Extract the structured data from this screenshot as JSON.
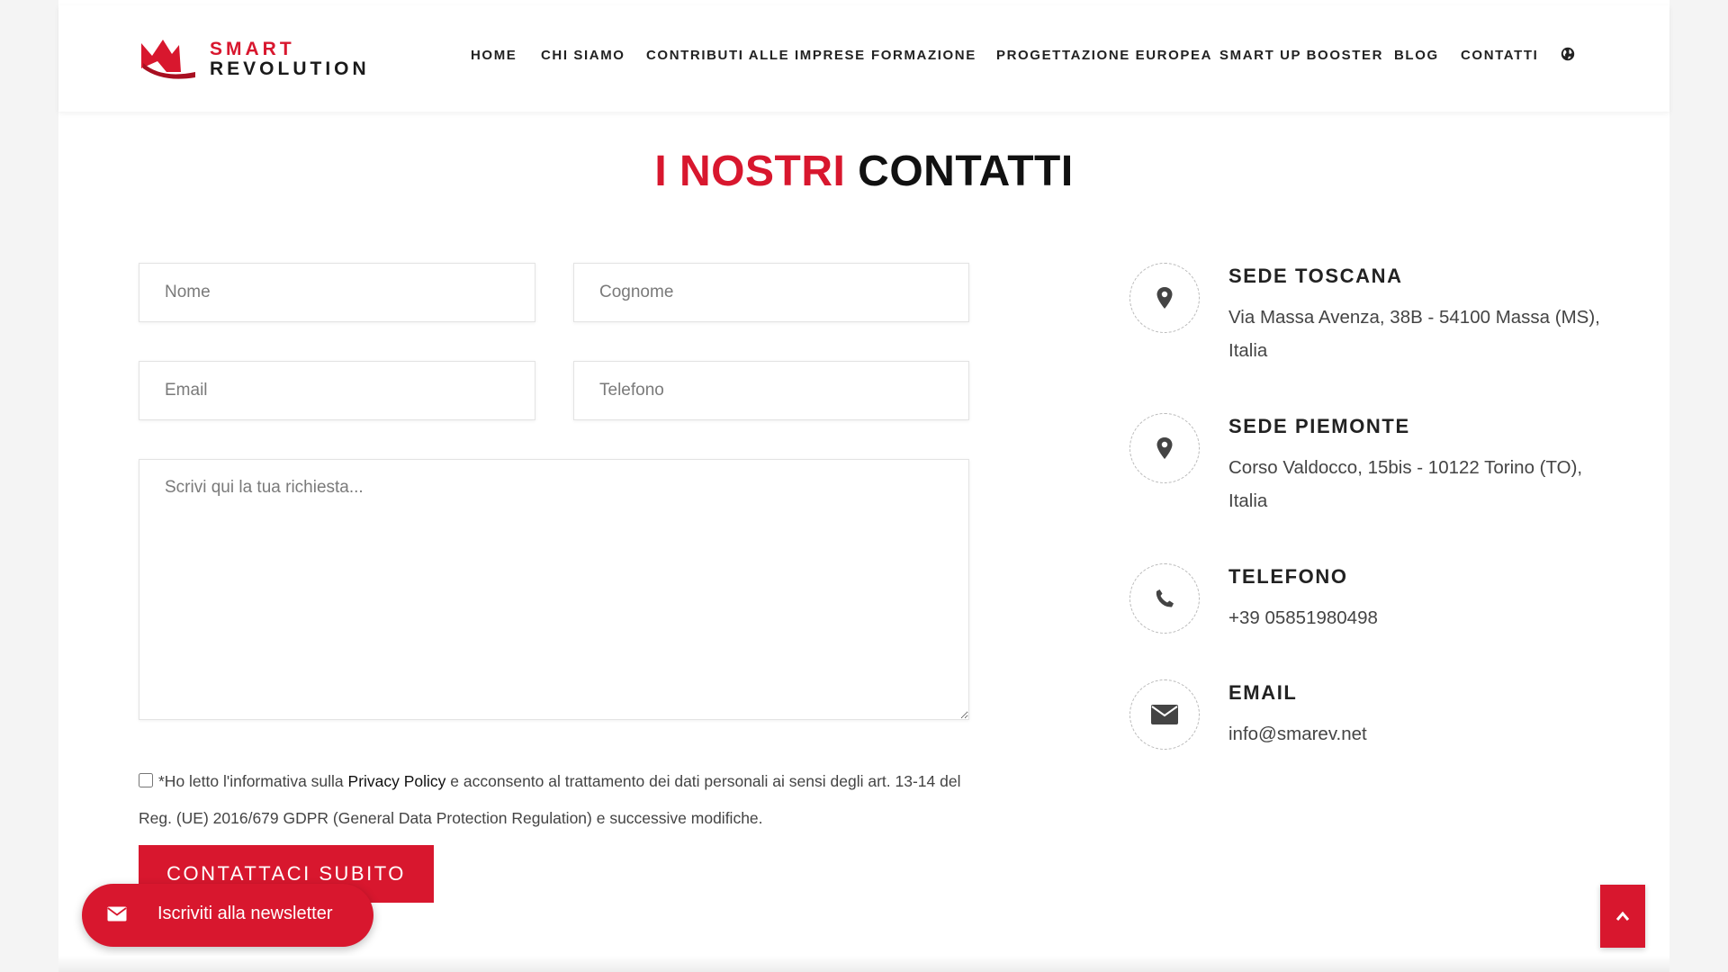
{
  "brand": {
    "line1": "SMART",
    "line2": "REVOLUTION",
    "accent_color": "#d8172e"
  },
  "nav": {
    "items": [
      {
        "label": "HOME"
      },
      {
        "label": "CHI SIAMO"
      },
      {
        "label": "CONTRIBUTI ALLE IMPRESE"
      },
      {
        "label": "FORMAZIONE"
      },
      {
        "label": "PROGETTAZIONE EUROPEA"
      },
      {
        "label": "SMART UP BOOSTER"
      },
      {
        "label": "BLOG"
      },
      {
        "label": "CONTATTI"
      }
    ],
    "language_icon": "globe-icon"
  },
  "page_title": {
    "highlight": "I NOSTRI",
    "rest": "CONTATTI"
  },
  "form": {
    "nome_placeholder": "Nome",
    "cognome_placeholder": "Cognome",
    "email_placeholder": "Email",
    "telefono_placeholder": "Telefono",
    "message_placeholder": "Scrivi qui la tua richiesta...",
    "consent_before": "*Ho letto l'informativa sulla ",
    "consent_link": "Privacy Policy",
    "consent_after": " e acconsento al trattamento dei dati personali ai sensi degli art. 13-14 del Reg. (UE) 2016/679 GDPR (General Data Protection Regulation) e successive modifiche.",
    "submit_label": "CONTATTACI SUBITO"
  },
  "contacts": [
    {
      "title": "SEDE TOSCANA",
      "text": "Via Massa Avenza, 38B - 54100 Massa (MS), Italia",
      "icon": "map-pin-icon"
    },
    {
      "title": "SEDE PIEMONTE",
      "text": "Corso Valdocco, 15bis - 10122 Torino (TO), Italia",
      "icon": "map-pin-icon"
    },
    {
      "title": "TELEFONO",
      "text": "+39 05851980498",
      "icon": "phone-icon"
    },
    {
      "title": "EMAIL",
      "text": "info@smarev.net",
      "icon": "envelope-icon"
    }
  ],
  "newsletter": {
    "label": "Iscriviti alla newsletter",
    "icon": "envelope-icon"
  },
  "scroll_top_icon": "chevron-up-icon"
}
